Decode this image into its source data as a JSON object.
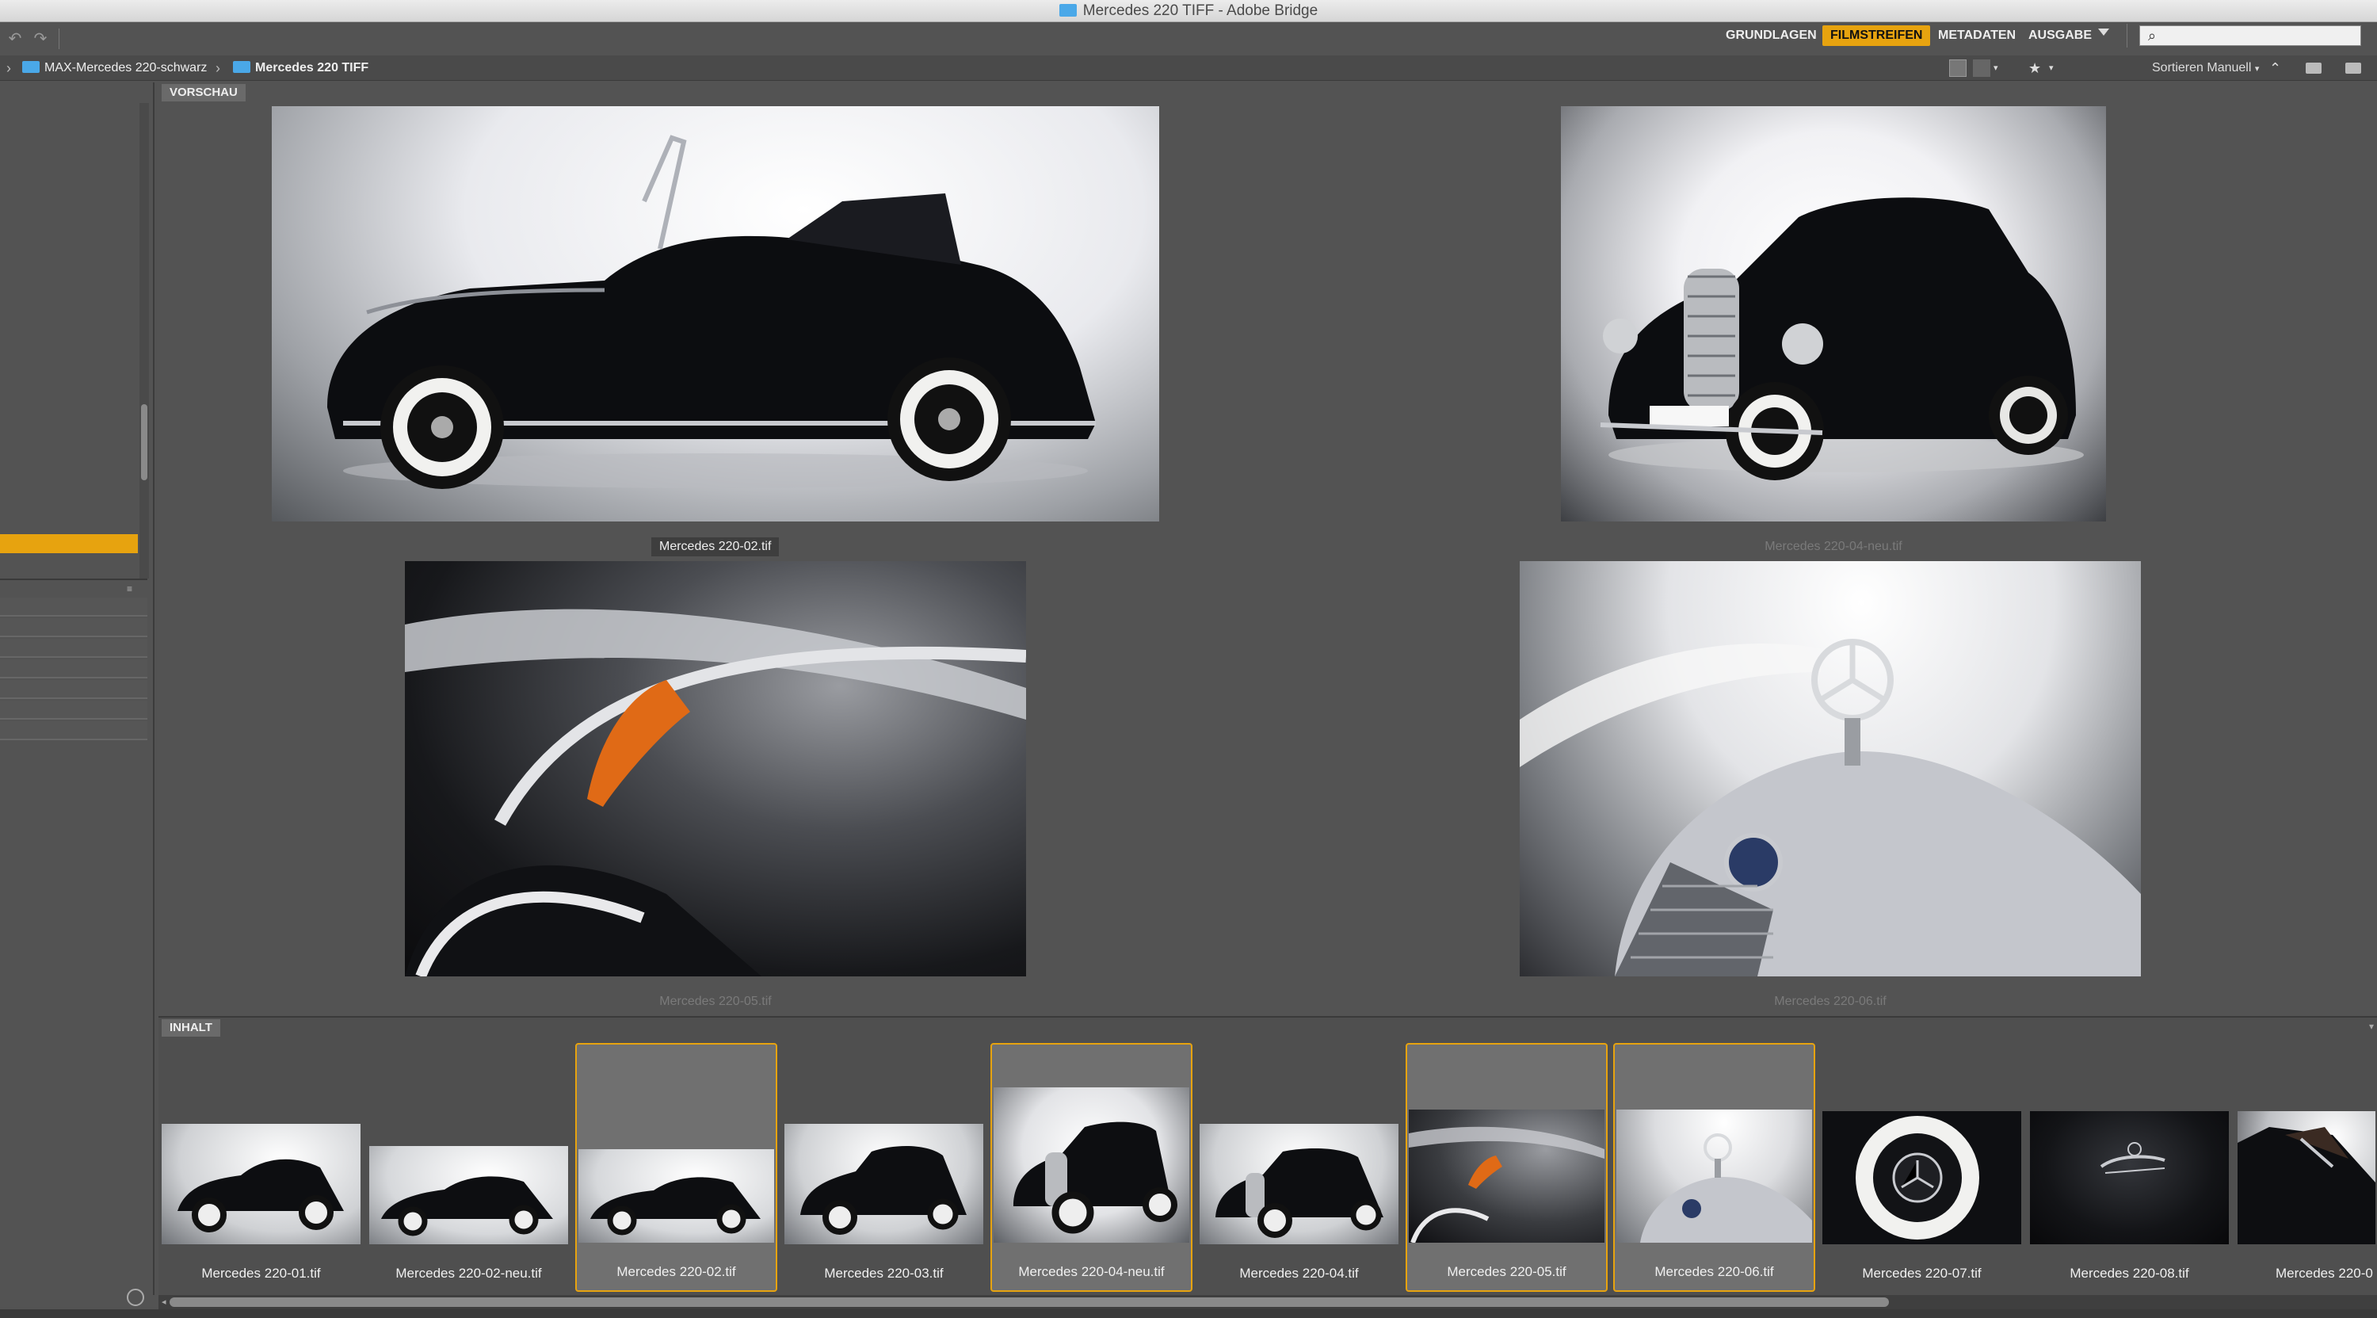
{
  "window": {
    "title": "Mercedes 220 TIFF - Adobe Bridge"
  },
  "toolbar": {
    "workspaces": [
      {
        "label": "GRUNDLAGEN",
        "active": false
      },
      {
        "label": "FILMSTREIFEN",
        "active": true
      },
      {
        "label": "METADATEN",
        "active": false
      },
      {
        "label": "AUSGABE",
        "active": false
      }
    ],
    "search": {
      "value": "",
      "placeholder": ""
    }
  },
  "path": {
    "items": [
      "MAX-Mercedes 220-schwarz",
      "Mercedes 220 TIFF"
    ],
    "sort_label": "Sortieren Manuell"
  },
  "preview": {
    "tab_label": "VORSCHAU",
    "items": [
      {
        "caption": "Mercedes 220-02.tif",
        "selected": true
      },
      {
        "caption": "Mercedes 220-04-neu.tif",
        "selected": false
      },
      {
        "caption": "Mercedes 220-05.tif",
        "selected": false
      },
      {
        "caption": "Mercedes 220-06.tif",
        "selected": false
      }
    ]
  },
  "content": {
    "tab_label": "INHALT",
    "thumbnails": [
      {
        "label": "Mercedes 220-01.tif",
        "selected": false
      },
      {
        "label": "Mercedes 220-02-neu.tif",
        "selected": false
      },
      {
        "label": "Mercedes 220-02.tif",
        "selected": true
      },
      {
        "label": "Mercedes 220-03.tif",
        "selected": false
      },
      {
        "label": "Mercedes 220-04-neu.tif",
        "selected": true
      },
      {
        "label": "Mercedes 220-04.tif",
        "selected": false
      },
      {
        "label": "Mercedes 220-05.tif",
        "selected": true
      },
      {
        "label": "Mercedes 220-06.tif",
        "selected": true
      },
      {
        "label": "Mercedes 220-07.tif",
        "selected": false
      },
      {
        "label": "Mercedes 220-08.tif",
        "selected": false
      },
      {
        "label": "Mercedes 220-0",
        "selected": false
      }
    ]
  },
  "colors": {
    "accent": "#e7a30f",
    "panel": "#535353",
    "selection_border": "#e7a30f"
  }
}
